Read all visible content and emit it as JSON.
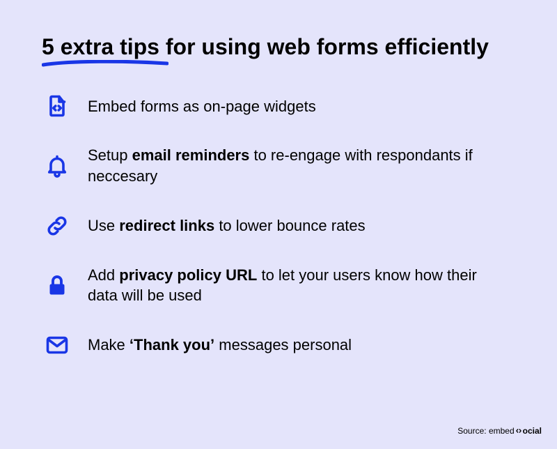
{
  "heading": "5 extra tips for using web forms efficiently",
  "tips": [
    {
      "icon": "file-code-icon",
      "segments": [
        {
          "t": "Embed forms as on-page widgets",
          "b": false
        }
      ]
    },
    {
      "icon": "bell-icon",
      "segments": [
        {
          "t": "Setup ",
          "b": false
        },
        {
          "t": "email reminders",
          "b": true
        },
        {
          "t": " to re-engage with respondants if neccesary",
          "b": false
        }
      ]
    },
    {
      "icon": "link-icon",
      "segments": [
        {
          "t": "Use ",
          "b": false
        },
        {
          "t": "redirect links",
          "b": true
        },
        {
          "t": " to lower bounce rates",
          "b": false
        }
      ]
    },
    {
      "icon": "lock-icon",
      "segments": [
        {
          "t": "Add ",
          "b": false
        },
        {
          "t": "privacy policy URL",
          "b": true
        },
        {
          "t": " to let your users know how their data will be used",
          "b": false
        }
      ]
    },
    {
      "icon": "envelope-icon",
      "segments": [
        {
          "t": "Make ",
          "b": false
        },
        {
          "t": "‘Thank you’",
          "b": true
        },
        {
          "t": " messages personal",
          "b": false
        }
      ]
    }
  ],
  "source": {
    "prefix": "Source: ",
    "brand_a": "embed",
    "brand_b": "ocial"
  },
  "colors": {
    "accent": "#1936e6",
    "bg": "#e4e4fb",
    "text": "#000"
  }
}
